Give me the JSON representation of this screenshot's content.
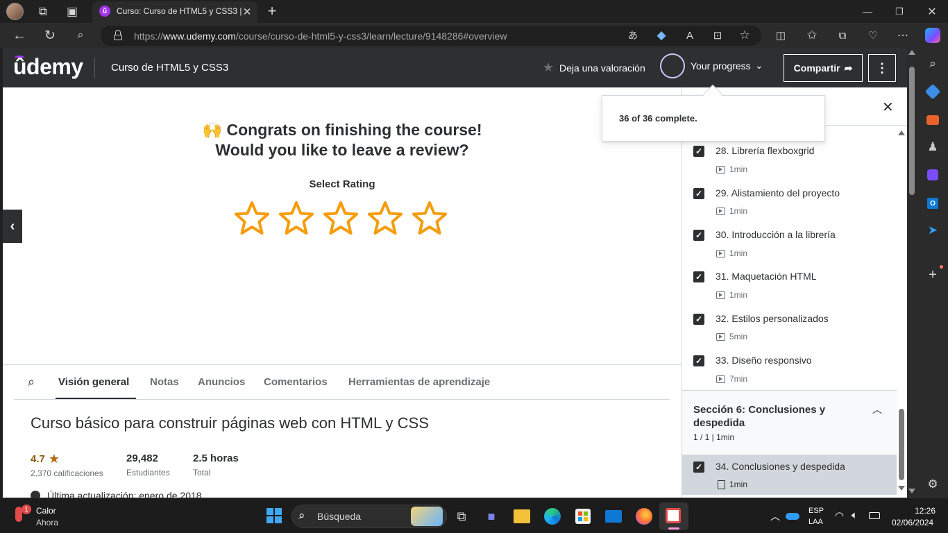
{
  "browser": {
    "tab_title": "Curso: Curso de HTML5 y CSS3 |",
    "url_prefix": "https://",
    "url_domain": "www.udemy.com",
    "url_path": "/course/curso-de-html5-y-css3/learn/lecture/9148286#overview"
  },
  "header": {
    "logo": "ûdemy",
    "course_title": "Curso de HTML5 y CSS3",
    "rate_label": "Deja una valoración",
    "progress_label": "Your progress",
    "share_label": "Compartir"
  },
  "progress_popup": {
    "text": "36 of 36 complete."
  },
  "review": {
    "emoji": "🙌",
    "line1": "Congrats on finishing the course!",
    "line2": "Would you like to leave a review?",
    "select_label": "Select Rating",
    "star_color": "#f69c08"
  },
  "tabs": [
    "Visión general",
    "Notas",
    "Anuncios",
    "Comentarios",
    "Herramientas de aprendizaje"
  ],
  "overview": {
    "heading": "Curso básico para construir páginas web con HTML y CSS",
    "rating_value": "4.7",
    "rating_count": "2,370 calificaciones",
    "students_value": "29,482",
    "students_label": "Estudiantes",
    "hours_value": "2.5 horas",
    "hours_label": "Total",
    "last_update": "Última actualización: enero de 2018"
  },
  "sidebar": {
    "lectures": [
      {
        "title": "28. Librería flexboxgrid",
        "duration": "1min"
      },
      {
        "title": "29. Alistamiento del proyecto",
        "duration": "1min"
      },
      {
        "title": "30. Introducción a la librería",
        "duration": "1min"
      },
      {
        "title": "31. Maquetación HTML",
        "duration": "1min"
      },
      {
        "title": "32. Estilos personalizados",
        "duration": "5min"
      },
      {
        "title": "33. Diseño responsivo",
        "duration": "7min"
      }
    ],
    "section": {
      "title": "Sección 6: Conclusiones y despedida",
      "meta": "1 / 1 | 1min"
    },
    "last_lecture": {
      "title": "34. Conclusiones y despedida",
      "duration": "1min"
    }
  },
  "taskbar": {
    "weather_title": "Calor",
    "weather_sub": "Ahora",
    "weather_badge": "1",
    "search_label": "Búsqueda",
    "lang_top": "ESP",
    "lang_bottom": "LAA",
    "time": "12:26",
    "date": "02/06/2024"
  },
  "colors": {
    "udemy_dark": "#2d2f31",
    "accent_purple": "#a435f0",
    "taskbar": "#1c1c1c"
  }
}
